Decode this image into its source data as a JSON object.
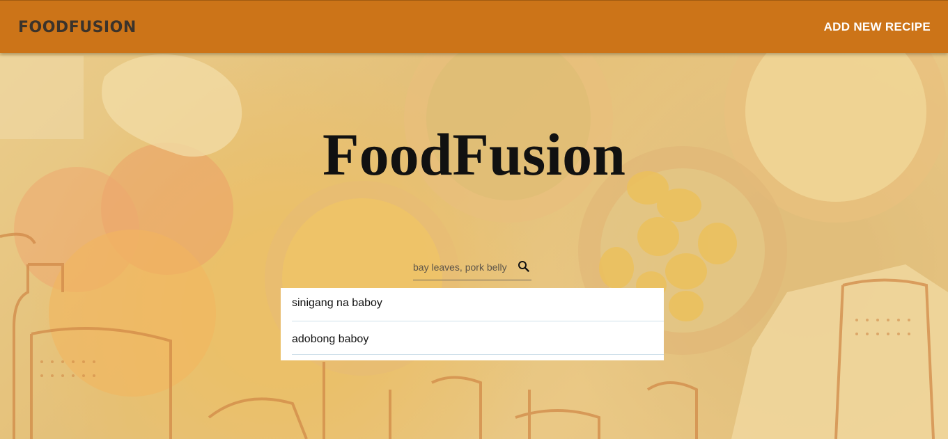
{
  "navbar": {
    "brand": "FOODFUSION",
    "add_recipe_link": "ADD NEW RECIPE"
  },
  "hero": {
    "title": "FoodFusion"
  },
  "search": {
    "placeholder": "bay leaves, pork belly",
    "value": "",
    "icon": "search-icon"
  },
  "suggestions": [
    {
      "label": "sinigang na baboy"
    },
    {
      "label": "adobong baboy"
    }
  ],
  "colors": {
    "navbar": "#cc7418",
    "brand_text": "#3b332b",
    "nav_link": "#ffffff",
    "title": "#111111"
  }
}
